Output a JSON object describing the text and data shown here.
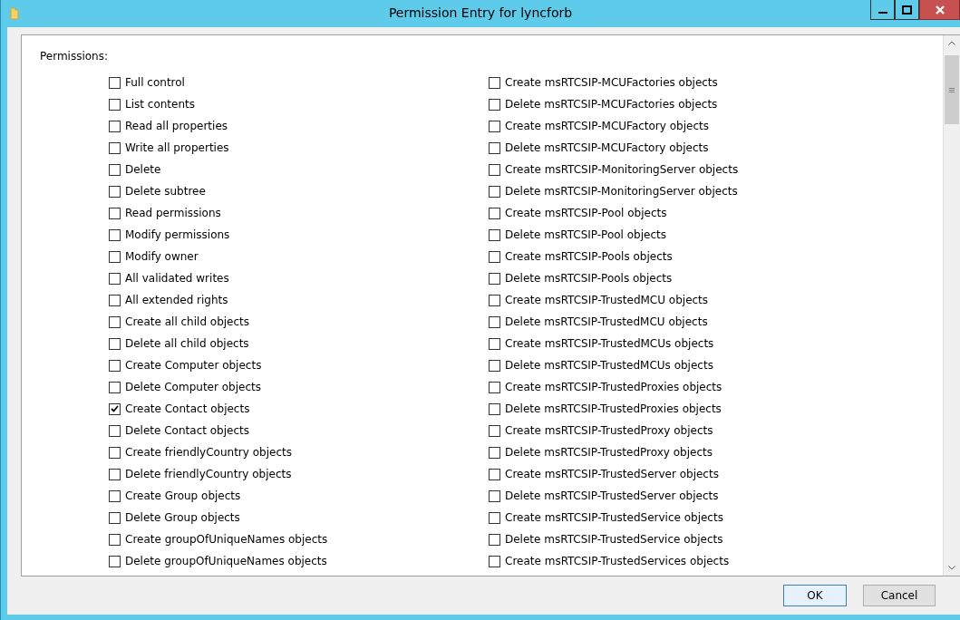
{
  "window": {
    "title": "Permission Entry for lyncforb"
  },
  "permissions_label": "Permissions:",
  "columns": [
    {
      "items": [
        {
          "label": "Full control",
          "checked": false
        },
        {
          "label": "List contents",
          "checked": false
        },
        {
          "label": "Read all properties",
          "checked": false
        },
        {
          "label": "Write all properties",
          "checked": false
        },
        {
          "label": "Delete",
          "checked": false
        },
        {
          "label": "Delete subtree",
          "checked": false
        },
        {
          "label": "Read permissions",
          "checked": false
        },
        {
          "label": "Modify permissions",
          "checked": false
        },
        {
          "label": "Modify owner",
          "checked": false
        },
        {
          "label": "All validated writes",
          "checked": false
        },
        {
          "label": "All extended rights",
          "checked": false
        },
        {
          "label": "Create all child objects",
          "checked": false
        },
        {
          "label": "Delete all child objects",
          "checked": false
        },
        {
          "label": "Create Computer objects",
          "checked": false
        },
        {
          "label": "Delete Computer objects",
          "checked": false
        },
        {
          "label": "Create Contact objects",
          "checked": true
        },
        {
          "label": "Delete Contact objects",
          "checked": false
        },
        {
          "label": "Create friendlyCountry objects",
          "checked": false
        },
        {
          "label": "Delete friendlyCountry objects",
          "checked": false
        },
        {
          "label": "Create Group objects",
          "checked": false
        },
        {
          "label": "Delete Group objects",
          "checked": false
        },
        {
          "label": "Create groupOfUniqueNames objects",
          "checked": false
        },
        {
          "label": "Delete groupOfUniqueNames objects",
          "checked": false
        }
      ]
    },
    {
      "items": [
        {
          "label": "Create msRTCSIP-MCUFactories objects",
          "checked": false
        },
        {
          "label": "Delete msRTCSIP-MCUFactories objects",
          "checked": false
        },
        {
          "label": "Create msRTCSIP-MCUFactory objects",
          "checked": false
        },
        {
          "label": "Delete msRTCSIP-MCUFactory objects",
          "checked": false
        },
        {
          "label": "Create msRTCSIP-MonitoringServer objects",
          "checked": false
        },
        {
          "label": "Delete msRTCSIP-MonitoringServer objects",
          "checked": false
        },
        {
          "label": "Create msRTCSIP-Pool objects",
          "checked": false
        },
        {
          "label": "Delete msRTCSIP-Pool objects",
          "checked": false
        },
        {
          "label": "Create msRTCSIP-Pools objects",
          "checked": false
        },
        {
          "label": "Delete msRTCSIP-Pools objects",
          "checked": false
        },
        {
          "label": "Create msRTCSIP-TrustedMCU objects",
          "checked": false
        },
        {
          "label": "Delete msRTCSIP-TrustedMCU objects",
          "checked": false
        },
        {
          "label": "Create msRTCSIP-TrustedMCUs objects",
          "checked": false
        },
        {
          "label": "Delete msRTCSIP-TrustedMCUs objects",
          "checked": false
        },
        {
          "label": "Create msRTCSIP-TrustedProxies objects",
          "checked": false
        },
        {
          "label": "Delete msRTCSIP-TrustedProxies objects",
          "checked": false
        },
        {
          "label": "Create msRTCSIP-TrustedProxy objects",
          "checked": false
        },
        {
          "label": "Delete msRTCSIP-TrustedProxy objects",
          "checked": false
        },
        {
          "label": "Create msRTCSIP-TrustedServer objects",
          "checked": false
        },
        {
          "label": "Delete msRTCSIP-TrustedServer objects",
          "checked": false
        },
        {
          "label": "Create msRTCSIP-TrustedService objects",
          "checked": false
        },
        {
          "label": "Delete msRTCSIP-TrustedService objects",
          "checked": false
        },
        {
          "label": "Create msRTCSIP-TrustedServices objects",
          "checked": false
        }
      ]
    }
  ],
  "buttons": [
    "OK",
    "Cancel"
  ]
}
